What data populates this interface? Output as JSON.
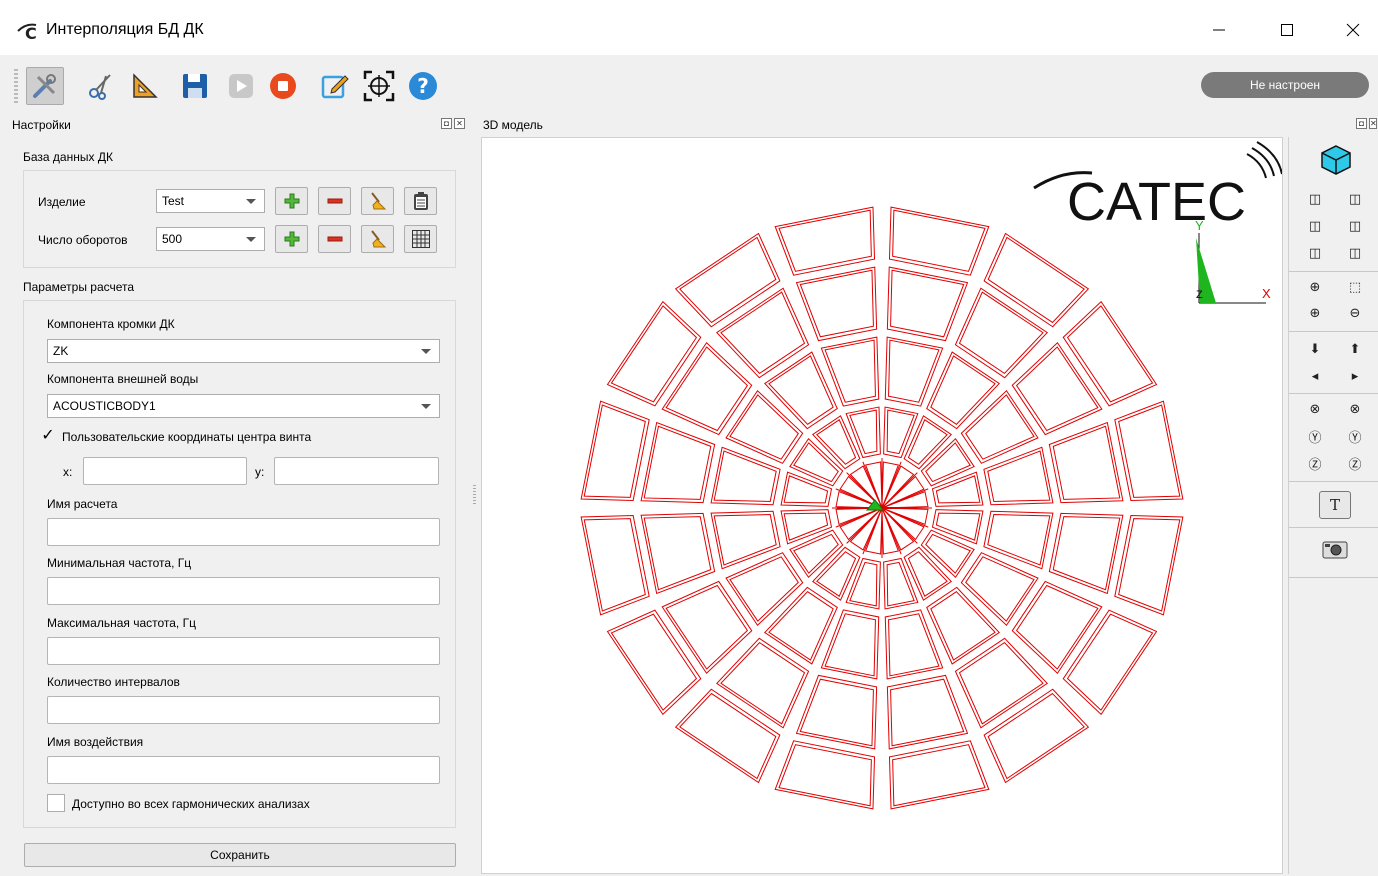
{
  "window": {
    "title": "Интерполяция БД ДК"
  },
  "toolbar": {
    "buttons": [
      "settings",
      "cut",
      "measure",
      "save",
      "run",
      "stop",
      "edit",
      "target",
      "help"
    ],
    "status": "Не настроен"
  },
  "settings_panel": {
    "title": "Настройки",
    "db_section": "База данных ДК",
    "product_label": "Изделие",
    "product_value": "Test",
    "rpm_label": "Число оборотов",
    "rpm_value": "500",
    "params_section": "Параметры расчета",
    "edge_component_label": "Компонента кромки ДК",
    "edge_component_value": "ZK",
    "water_component_label": "Компонента внешней воды",
    "water_component_value": "ACOUSTICBODY1",
    "custom_coords_label": "Пользовательские координаты центра винта",
    "custom_coords_checked": true,
    "x_label": "x:",
    "y_label": "y:",
    "x_value": "",
    "y_value": "",
    "calc_name_label": "Имя расчета",
    "calc_name_value": "",
    "min_freq_label": "Минимальная частота, Гц",
    "min_freq_value": "",
    "max_freq_label": "Максимальная частота, Гц",
    "max_freq_value": "",
    "intervals_label": "Количество интервалов",
    "intervals_value": "",
    "impact_name_label": "Имя воздействия",
    "impact_name_value": "",
    "all_harmonic_label": "Доступно во всех гармонических анализах",
    "all_harmonic_checked": false,
    "save_label": "Сохранить"
  },
  "model_panel": {
    "title": "3D модель",
    "logo": "CATEC",
    "axis_x": "X",
    "axis_y": "Y",
    "axis_z": "Z",
    "mesh_color": "#e00000",
    "rings": 5,
    "sectors": 16
  }
}
